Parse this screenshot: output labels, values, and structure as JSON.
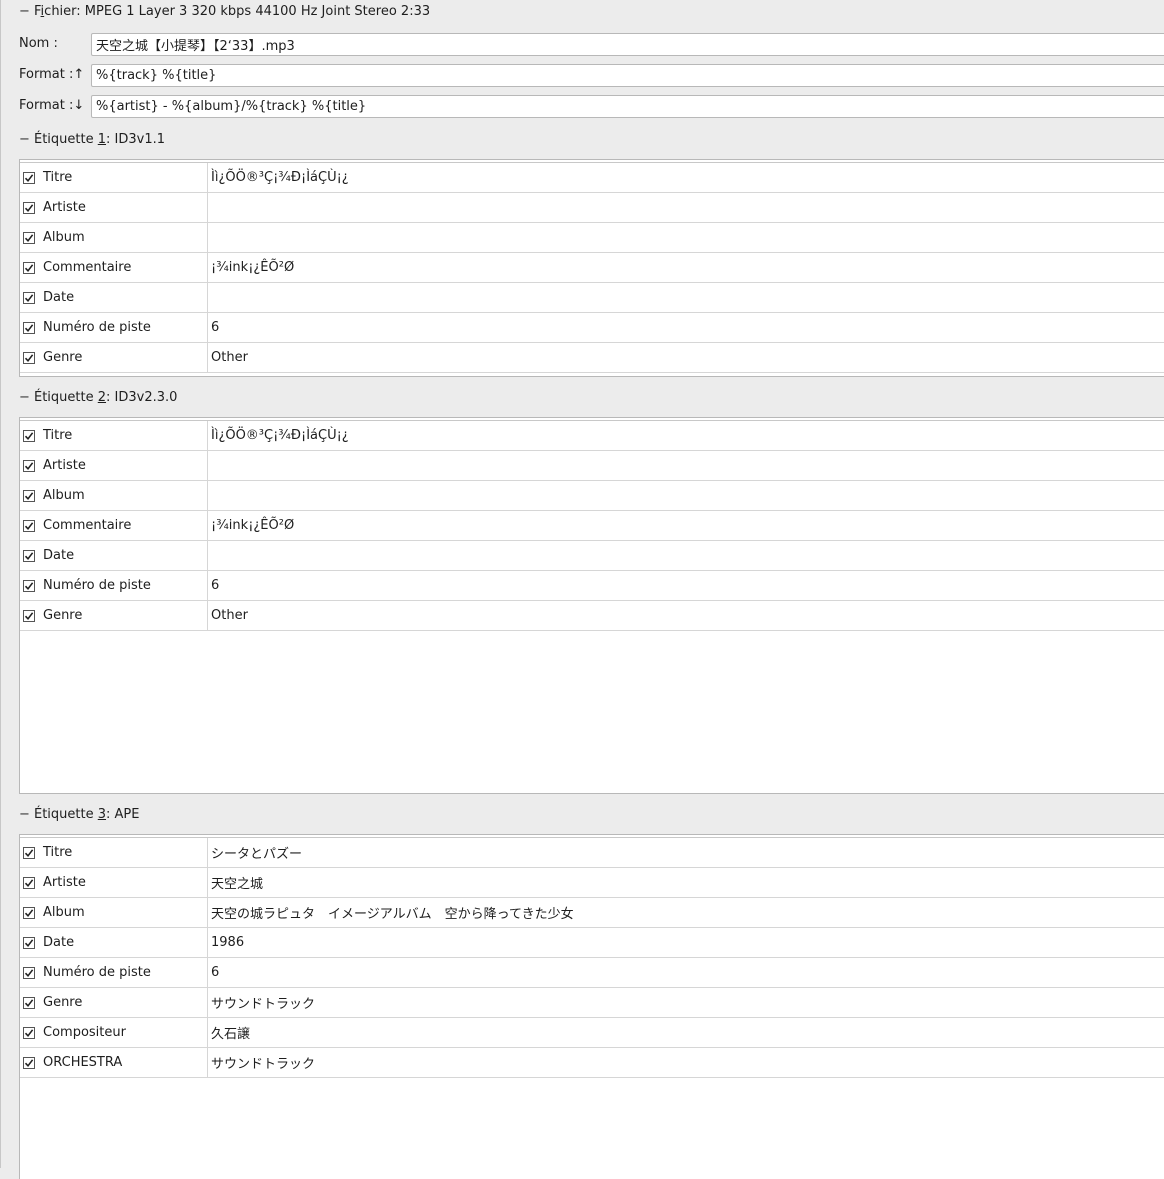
{
  "file_header": {
    "toggle": "−",
    "label_pre": "F",
    "label_acc": "i",
    "label_post": "chier: MPEG 1 Layer 3 320 kbps 44100 Hz Joint Stereo 2:33"
  },
  "form": {
    "name_label": "Nom :",
    "name_value": "天空之城【小提琴】【2‘33】.mp3",
    "format_up_label": "Format :↑",
    "format_up_value": "%{track} %{title}",
    "format_down_label": "Format :↓",
    "format_down_value": "%{artist} - %{album}/%{track} %{title}"
  },
  "tags": [
    {
      "toggle": "−",
      "prefix": "Étiquette ",
      "accel": "1",
      "suffix": ": ID3v1.1",
      "rows": [
        {
          "field": "Titre",
          "value": "Ìì¿ÕÖ®³Ç¡¾Ð¡ÌáÇÙ¡¿"
        },
        {
          "field": "Artiste",
          "value": ""
        },
        {
          "field": "Album",
          "value": ""
        },
        {
          "field": "Commentaire",
          "value": "¡¾ink¡¿ÊÕ²Ø"
        },
        {
          "field": "Date",
          "value": ""
        },
        {
          "field": "Numéro de piste",
          "value": "6"
        },
        {
          "field": "Genre",
          "value": "Other"
        }
      ]
    },
    {
      "toggle": "−",
      "prefix": "Étiquette ",
      "accel": "2",
      "suffix": ": ID3v2.3.0",
      "rows": [
        {
          "field": "Titre",
          "value": "Ìì¿ÕÖ®³Ç¡¾Ð¡ÌáÇÙ¡¿"
        },
        {
          "field": "Artiste",
          "value": ""
        },
        {
          "field": "Album",
          "value": ""
        },
        {
          "field": "Commentaire",
          "value": "¡¾ink¡¿ÊÕ²Ø"
        },
        {
          "field": "Date",
          "value": ""
        },
        {
          "field": "Numéro de piste",
          "value": "6"
        },
        {
          "field": "Genre",
          "value": "Other"
        }
      ]
    },
    {
      "toggle": "−",
      "prefix": "Étiquette ",
      "accel": "3",
      "suffix": ": APE",
      "rows": [
        {
          "field": "Titre",
          "value": "シータとパズー"
        },
        {
          "field": "Artiste",
          "value": "天空之城"
        },
        {
          "field": "Album",
          "value": "天空の城ラピュタ　イメージアルバム　空から降ってきた少女"
        },
        {
          "field": "Date",
          "value": "1986"
        },
        {
          "field": "Numéro de piste",
          "value": "6"
        },
        {
          "field": "Genre",
          "value": "サウンドトラック"
        },
        {
          "field": "Compositeur",
          "value": "久石譲"
        },
        {
          "field": "ORCHESTRA",
          "value": "サウンドトラック"
        }
      ]
    }
  ]
}
